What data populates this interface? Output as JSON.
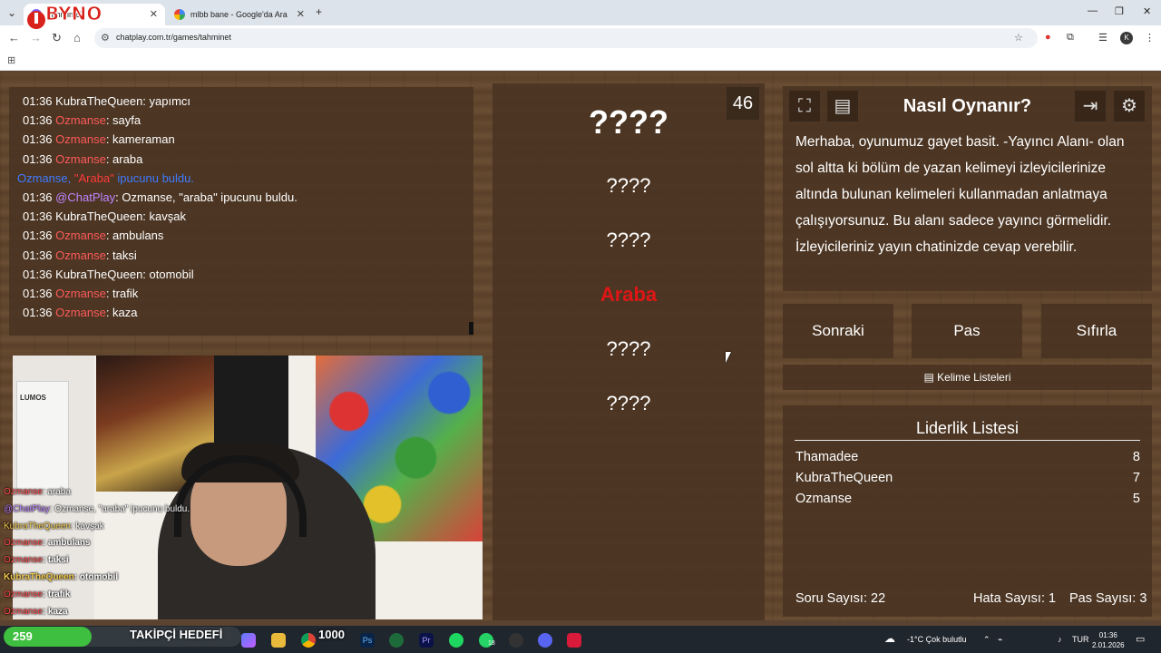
{
  "browser": {
    "tabs": [
      {
        "label": "Tahmin Et",
        "active": true
      },
      {
        "label": "mlbb bane - Google'da Ara",
        "active": false
      }
    ],
    "url": "chatplay.com.tr/games/tahminet",
    "profile_initial": "K",
    "extension_badge": "2"
  },
  "logo_text": "BYNO",
  "chat": {
    "messages": [
      {
        "time": "01:36",
        "user": "KubraTheQueen",
        "color": "white",
        "text": "yapımcı"
      },
      {
        "time": "01:36",
        "user": "Ozmanse",
        "color": "red",
        "text": "sayfa"
      },
      {
        "time": "01:36",
        "user": "Ozmanse",
        "color": "red",
        "text": "kameraman"
      },
      {
        "time": "01:36",
        "user": "Ozmanse",
        "color": "red",
        "text": "araba"
      },
      {
        "system": true,
        "user": "Ozmanse,",
        "quote": "\"Araba\"",
        "text": "ipucunu buldu."
      },
      {
        "time": "01:36",
        "user": "@ChatPlay",
        "color": "purple",
        "text": "Ozmanse, \"araba\" ipucunu buldu."
      },
      {
        "time": "01:36",
        "user": "KubraTheQueen",
        "color": "white",
        "text": "kavşak"
      },
      {
        "time": "01:36",
        "user": "Ozmanse",
        "color": "red",
        "text": "ambulans"
      },
      {
        "time": "01:36",
        "user": "Ozmanse",
        "color": "red",
        "text": "taksi"
      },
      {
        "time": "01:36",
        "user": "KubraTheQueen",
        "color": "white",
        "text": "otomobil"
      },
      {
        "time": "01:36",
        "user": "Ozmanse",
        "color": "red",
        "text": "trafik"
      },
      {
        "time": "01:36",
        "user": "Ozmanse",
        "color": "red",
        "text": "kaza"
      }
    ]
  },
  "game": {
    "timer": "46",
    "main_word": "????",
    "hints": [
      "????",
      "????",
      "Araba",
      "????",
      "????"
    ],
    "found_hint_index": 2
  },
  "info": {
    "title": "Nasıl Oynanır?",
    "text": "Merhaba, oyunumuz gayet basit. -Yayıncı Alanı- olan sol altta ki bölüm de yazan kelimeyi izleyicilerinize altında bulunan kelimeleri kullanmadan anlatmaya çalışıyorsunuz. Bu alanı sadece yayıncı görmelidir. İzleyicileriniz yayın chatinizde cevap verebilir."
  },
  "controls": {
    "next": "Sonraki",
    "pass": "Pas",
    "reset": "Sıfırla",
    "word_lists": "Kelime Listeleri"
  },
  "leaderboard": {
    "title": "Liderlik Listesi",
    "rows": [
      {
        "name": "Thamadee",
        "score": "8"
      },
      {
        "name": "KubraTheQueen",
        "score": "7"
      },
      {
        "name": "Ozmanse",
        "score": "5"
      }
    ],
    "question_count": "Soru Sayısı: 22",
    "error_count": "Hata Sayısı: 1",
    "pass_count": "Pas Sayısı: 3"
  },
  "overlay_chat": [
    {
      "user": "Ozmanse",
      "text": ": araba",
      "color": "red"
    },
    {
      "user": "@ChatPlay",
      "text": ": Ozmanse, \"araba\" ipucunu buldu.",
      "color": "purple"
    },
    {
      "user": "KubraTheQueen",
      "text": ": kavşak",
      "color": "gold"
    },
    {
      "user": "Ozmanse",
      "text": ": ambulans",
      "color": "red"
    },
    {
      "user": "Ozmanse",
      "text": ": taksi",
      "color": "red"
    },
    {
      "user": "KubraTheQueen",
      "text": ": otomobil",
      "color": "gold"
    },
    {
      "user": "Ozmanse",
      "text": ": trafik",
      "color": "red"
    },
    {
      "user": "Ozmanse",
      "text": ": kaza",
      "color": "red"
    }
  ],
  "stream_overlay": {
    "follower_count": "259",
    "follower_goal_label": "TAKİPÇİ HEDEFİ",
    "follower_progress": 0.37,
    "viewer_count": "1000"
  },
  "taskbar": {
    "weather": "-1°C  Çok bulutlu",
    "language": "TUR",
    "time": "01:36",
    "date": "2.01.2026",
    "badge": "18"
  }
}
